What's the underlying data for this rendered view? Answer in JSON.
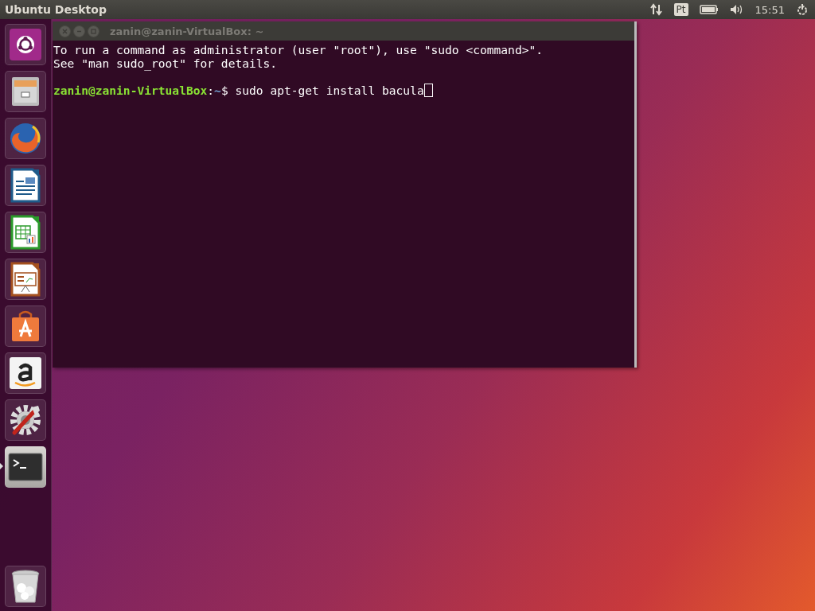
{
  "top_bar": {
    "title": "Ubuntu Desktop",
    "keyboard_layout": "Pt",
    "clock": "15:51"
  },
  "launcher": {
    "items": [
      {
        "kind": "dash",
        "running": false
      },
      {
        "kind": "files",
        "running": false
      },
      {
        "kind": "browser",
        "running": false
      },
      {
        "kind": "writer",
        "running": false
      },
      {
        "kind": "calc",
        "running": false
      },
      {
        "kind": "impress",
        "running": false
      },
      {
        "kind": "software",
        "running": false
      },
      {
        "kind": "amazon",
        "running": false
      },
      {
        "kind": "settings",
        "running": false
      },
      {
        "kind": "terminal",
        "running": true
      }
    ],
    "trash": {
      "kind": "trash",
      "running": false
    }
  },
  "terminal": {
    "title": "zanin@zanin-VirtualBox: ~",
    "lines": [
      "To run a command as administrator (user \"root\"), use \"sudo <command>\".",
      "See \"man sudo_root\" for details."
    ],
    "prompt": {
      "user_host": "zanin@zanin-VirtualBox",
      "separator": ":",
      "path": "~",
      "symbol": "$",
      "command": "sudo apt-get install bacula"
    }
  }
}
